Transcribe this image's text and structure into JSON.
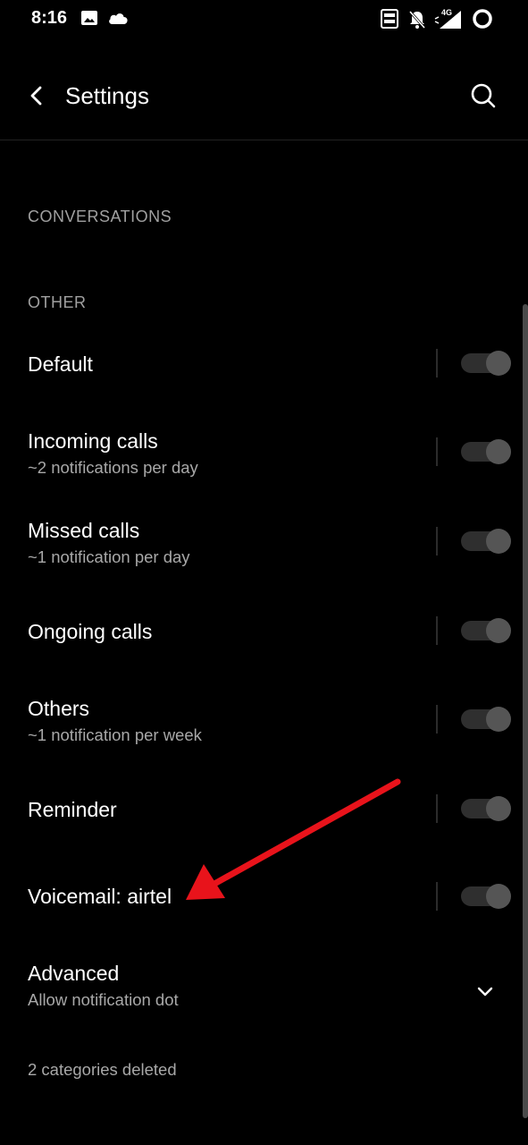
{
  "status_bar": {
    "time": "8:16",
    "icons": [
      "gallery-icon",
      "cloud-icon",
      "volte-icon",
      "bell-off-icon",
      "signal-4g-icon",
      "battery-ring-icon"
    ],
    "network_label": "4G"
  },
  "app_bar": {
    "title": "Settings",
    "back_icon": "back-arrow-icon",
    "search_icon": "search-icon"
  },
  "sections": {
    "conversations": "CONVERSATIONS",
    "other": "OTHER"
  },
  "channels": [
    {
      "title": "Default",
      "subtitle": "",
      "enabled": true
    },
    {
      "title": "Incoming calls",
      "subtitle": "~2 notifications per day",
      "enabled": true
    },
    {
      "title": "Missed calls",
      "subtitle": "~1 notification per day",
      "enabled": true
    },
    {
      "title": "Ongoing calls",
      "subtitle": "",
      "enabled": true
    },
    {
      "title": "Others",
      "subtitle": "~1 notification per week",
      "enabled": true
    },
    {
      "title": "Reminder",
      "subtitle": "",
      "enabled": true
    },
    {
      "title": "Voicemail: airtel",
      "subtitle": "",
      "enabled": true
    }
  ],
  "advanced": {
    "title": "Advanced",
    "subtitle": "Allow notification dot",
    "icon": "chevron-down-icon"
  },
  "footer": {
    "deleted_note": "2 categories deleted"
  },
  "colors": {
    "background": "#000000",
    "primary_text": "#ffffff",
    "secondary_text": "#a8a8a8",
    "annotation_arrow": "#e8131b"
  }
}
